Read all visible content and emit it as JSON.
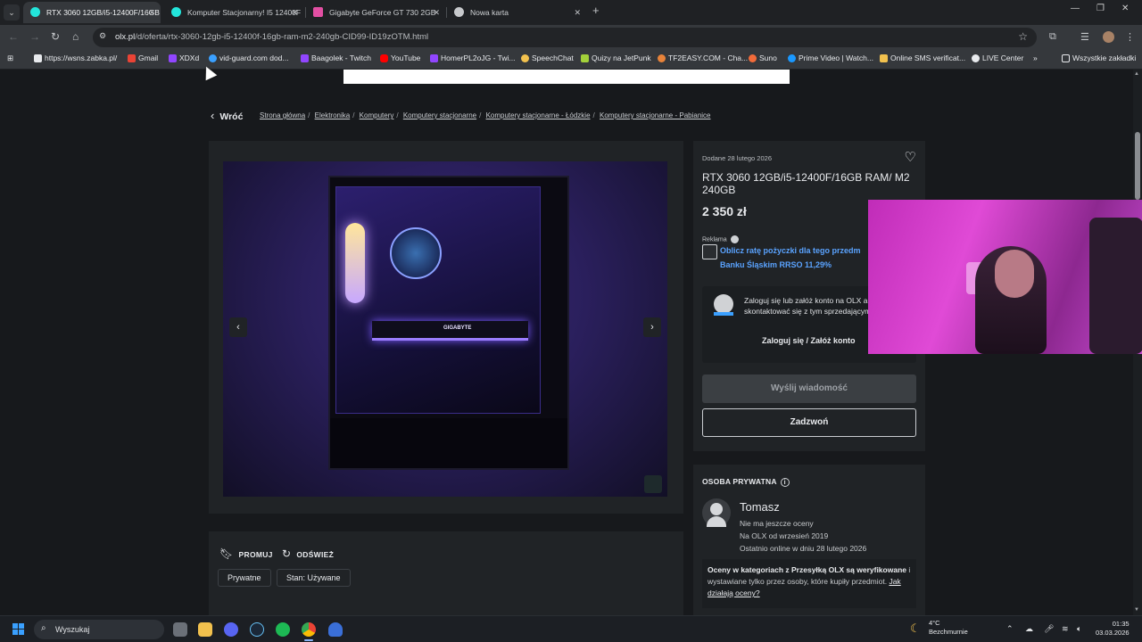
{
  "browser": {
    "tabs": [
      {
        "label": "RTX 3060 12GB/i5-12400F/16GB",
        "active": true,
        "favicon_color": "#23e5db"
      },
      {
        "label": "Komputer Stacjonarny! I5 12400F",
        "active": false,
        "favicon_color": "#23e5db"
      },
      {
        "label": "Gigabyte GeForce GT 730 2GB",
        "active": false,
        "favicon_color": "#e24fa3"
      },
      {
        "label": "Nowa karta",
        "active": false,
        "favicon_color": "#c7c9cc"
      }
    ],
    "close_glyph": "✕",
    "new_tab_glyph": "+",
    "url_domain": "olx.pl",
    "url_path": "/d/oferta/rtx-3060-12gb-i5-12400f-16gb-ram-m2-240gb-CID99-ID19zOTM.html",
    "bookmarks": [
      {
        "label": "https://wsns.zabka.pl/",
        "icon_color": "#e8eaed"
      },
      {
        "label": "Gmail",
        "icon_color": "#ea4335"
      },
      {
        "label": "XDXd",
        "icon_color": "#9146ff"
      },
      {
        "label": "vid-guard.com dod...",
        "icon_color": "#3aa0ff"
      },
      {
        "label": "Baagolek - Twitch",
        "icon_color": "#9146ff"
      },
      {
        "label": "YouTube",
        "icon_color": "#ff0000"
      },
      {
        "label": "HomerPL2oJG - Twi...",
        "icon_color": "#9146ff"
      },
      {
        "label": "SpeechChat",
        "icon_color": "#f2c14e"
      },
      {
        "label": "Quizy na JetPunk",
        "icon_color": "#a3d13a"
      },
      {
        "label": "TF2EASY.COM - Cha...",
        "icon_color": "#e8833a"
      },
      {
        "label": "Suno",
        "icon_color": "#f26b3a"
      },
      {
        "label": "Prime Video | Watch...",
        "icon_color": "#1a98ff"
      },
      {
        "label": "Online SMS verificat...",
        "icon_color": "#f2c14e"
      },
      {
        "label": "LIVE Center",
        "icon_color": "#e8eaed"
      }
    ],
    "bookmarks_more": "»",
    "all_bookmarks": "Wszystkie zakładki"
  },
  "page": {
    "back_label": "Wróć",
    "breadcrumbs": [
      "Strona główna",
      "Elektronika",
      "Komputery",
      "Komputery stacjonarne",
      "Komputery stacjonarne - Łódzkie",
      "Komputery stacjonarne - Pabianice"
    ],
    "gallery": {
      "brand_text": "GIGABYTE",
      "prev_glyph": "‹",
      "next_glyph": "›"
    },
    "actions": {
      "promote": "PROMUJ",
      "refresh": "ODŚWIEŻ"
    },
    "chips": [
      "Prywatne",
      "Stan: Używane"
    ],
    "listing": {
      "added": "Dodane 28 lutego 2026",
      "title": "RTX 3060 12GB/i5-12400F/16GB RAM/ M2 240GB",
      "price": "2 350 zł",
      "ad_label": "Reklama",
      "ad_line1": "Oblicz ratę pożyczki dla tego przedm",
      "ad_line2": "Banku Śląskim RRSO 11,29%",
      "login_text": "Zaloguj się lub załóż konto na OLX aby skontaktować się z tym sprzedającym",
      "login_link": "Zaloguj się / Załóż konto",
      "send_message": "Wyślij wiadomość",
      "call": "Zadzwoń"
    },
    "seller": {
      "heading": "OSOBA PRYWATNA",
      "name": "Tomasz",
      "rating": "Nie ma jeszcze oceny",
      "since": "Na OLX od wrzesień 2019",
      "last_online": "Ostatnio online w dniu 28 lutego 2026",
      "note_bold": "Oceny w kategoriach z Przesyłką OLX są weryfikowane",
      "note_rest": " i wystawiane tylko przez osoby, które kupiły przedmiot. ",
      "note_link": "Jak działają oceny?"
    }
  },
  "taskbar": {
    "search_placeholder": "Wyszukaj",
    "weather_temp": "4°C",
    "weather_desc": "Bezchmurnie",
    "time": "01:35",
    "date": "03.03.2026",
    "accent": "#3aa0ff"
  }
}
